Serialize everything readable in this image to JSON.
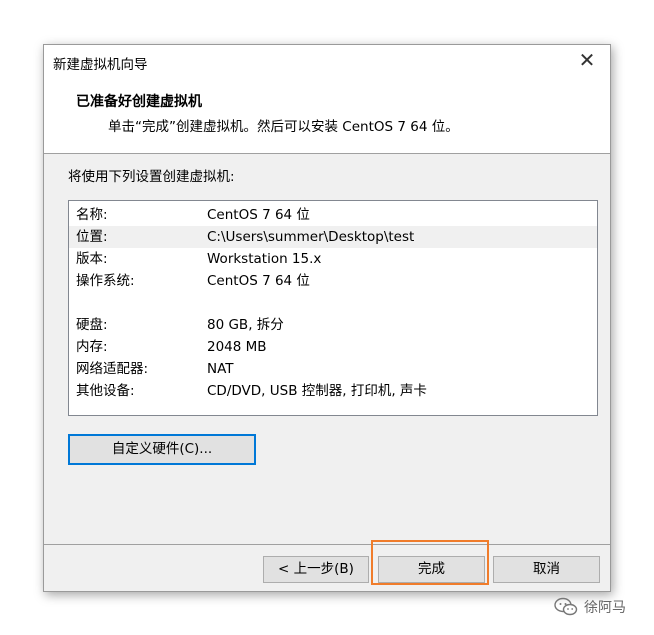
{
  "dialog": {
    "title": "新建虚拟机向导",
    "close_label": "✕",
    "header_title": "已准备好创建虚拟机",
    "header_desc": "单击“完成”创建虚拟机。然后可以安装 CentOS 7 64 位。",
    "intro": "将使用下列设置创建虚拟机:",
    "summary": [
      {
        "key": "名称:",
        "value": "CentOS 7 64 位"
      },
      {
        "key": "位置:",
        "value": "C:\\Users\\summer\\Desktop\\test"
      },
      {
        "key": "版本:",
        "value": "Workstation 15.x"
      },
      {
        "key": "操作系统:",
        "value": "CentOS 7 64 位"
      },
      {
        "key": "硬盘:",
        "value": "80 GB, 拆分"
      },
      {
        "key": "内存:",
        "value": "2048 MB"
      },
      {
        "key": "网络适配器:",
        "value": "NAT"
      },
      {
        "key": "其他设备:",
        "value": "CD/DVD, USB 控制器, 打印机, 声卡"
      }
    ],
    "customize_label": "自定义硬件(C)...",
    "back_label": "< 上一步(B)",
    "finish_label": "完成",
    "cancel_label": "取消"
  },
  "watermark": {
    "text": "徐阿马",
    "icon": "wechat-icon"
  },
  "colors": {
    "focus": "#0078d7",
    "highlight_mark": "#f07c2b"
  }
}
